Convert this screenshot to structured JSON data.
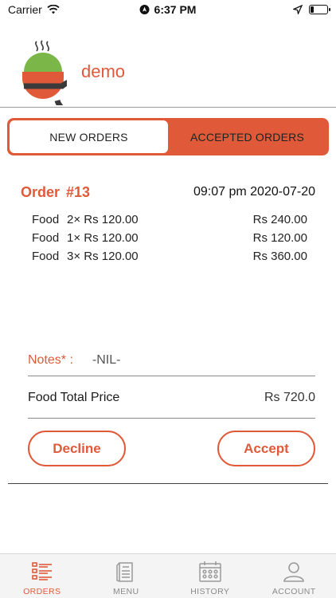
{
  "status_bar": {
    "carrier": "Carrier",
    "time": "6:37 PM",
    "battery_level": 0.2
  },
  "header": {
    "brand_name": "demo",
    "logo_icon": "food-cloche-e-logo-icon"
  },
  "segment": {
    "tabs": [
      {
        "label": "NEW ORDERS",
        "active": true
      },
      {
        "label": "ACCEPTED ORDERS",
        "active": false
      }
    ]
  },
  "order": {
    "title": "Order",
    "number": "#13",
    "datetime": "09:07 pm 2020-07-20",
    "items": [
      {
        "name": "Food",
        "qty_price": "2× Rs 120.00",
        "total": "Rs 240.00"
      },
      {
        "name": "Food",
        "qty_price": "1× Rs 120.00",
        "total": "Rs 120.00"
      },
      {
        "name": "Food",
        "qty_price": "3× Rs 120.00",
        "total": "Rs 360.00"
      }
    ],
    "notes_label": "Notes* :",
    "notes_value": "-NIL-",
    "total_label": "Food Total Price",
    "total_value": "Rs 720.0",
    "decline_label": "Decline",
    "accept_label": "Accept"
  },
  "tabbar": {
    "items": [
      {
        "label": "ORDERS",
        "icon": "orders-list-icon",
        "active": true
      },
      {
        "label": "MENU",
        "icon": "menu-card-icon",
        "active": false
      },
      {
        "label": "HISTORY",
        "icon": "calendar-history-icon",
        "active": false
      },
      {
        "label": "ACCOUNT",
        "icon": "user-account-icon",
        "active": false
      }
    ]
  },
  "colors": {
    "accent": "#e05a3a",
    "logo_green": "#7ab648",
    "logo_orange": "#e05a3a",
    "logo_dark": "#3a3a3a",
    "inactive_icon": "#9a9a9a"
  }
}
